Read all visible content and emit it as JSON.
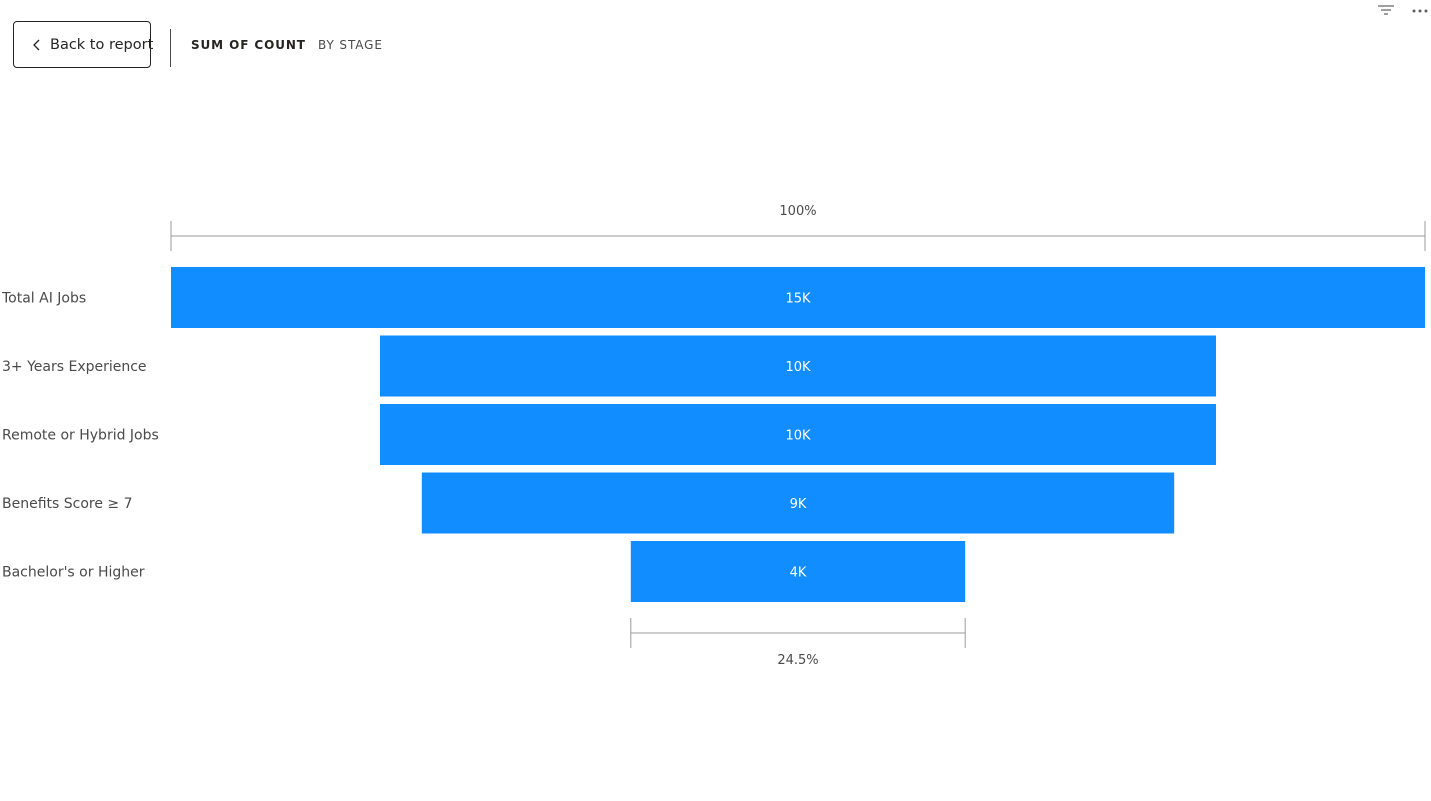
{
  "toolbar": {
    "back_label": "Back to report",
    "title": "SUM OF COUNT",
    "subtitle": "BY STAGE",
    "icons": [
      "filter-icon",
      "more-options-icon"
    ]
  },
  "chart_data": {
    "type": "funnel",
    "measure": "Sum of Count",
    "color": "#118DFF",
    "categories": [
      "Total AI Jobs",
      "3+ Years Experience",
      "Remote or Hybrid Jobs",
      "Benefits Score ≥ 7",
      "Bachelor's or Higher"
    ],
    "values": [
      15000,
      10000,
      10000,
      9000,
      4000
    ],
    "data_labels": [
      "15K",
      "10K",
      "10K",
      "9K",
      "4K"
    ],
    "top_percent_label": "100%",
    "bottom_percent_label": "24.5%"
  }
}
